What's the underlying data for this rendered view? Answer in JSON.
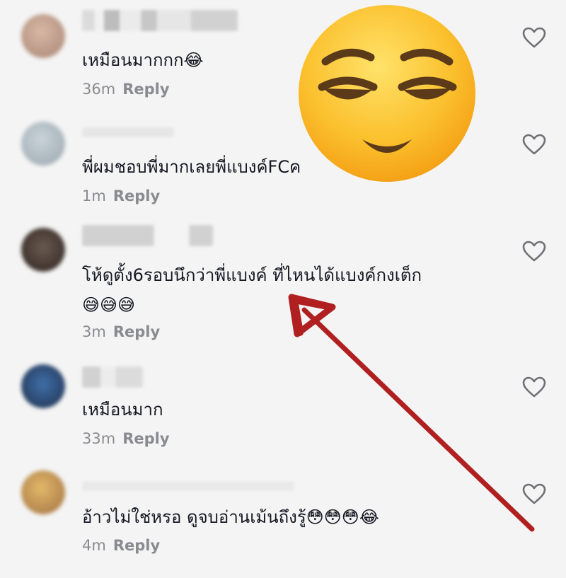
{
  "comments": [
    {
      "text": "เหมือนมากกก😂",
      "time": "36m",
      "reply": "Reply"
    },
    {
      "text": "พี่ผมชอบพี่มากเลยพี่แบงค์FCค",
      "time": "1m",
      "reply": "Reply"
    },
    {
      "text": "โห้ดูตั้ง6รอบนึกว่าพี่แบงค์ ที่ไหนได้แบงค์กงเต็ก",
      "text2": "😅😅😅",
      "time": "3m",
      "reply": "Reply"
    },
    {
      "text": "เหมือนมาก",
      "time": "33m",
      "reply": "Reply"
    },
    {
      "text": "อ้าวไม่ใช่หรอ ดูจบอ่านเม้นถึงรู้😳😳😳😂",
      "time": "4m",
      "reply": "Reply"
    }
  ],
  "icons": {
    "like": "heart-outline-icon",
    "overlay": "relieved-face-emoji",
    "annotation": "red-arrow"
  },
  "colors": {
    "background": "#f4f4f4",
    "text": "#161823",
    "meta": "#8a8b91",
    "arrow": "#b02020",
    "heart": "#6f7075"
  }
}
